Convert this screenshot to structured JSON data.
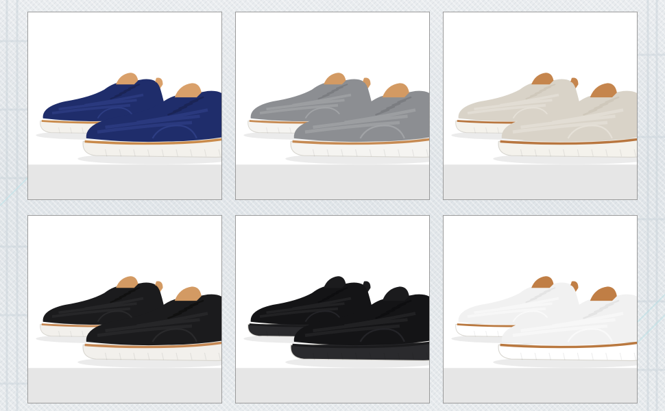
{
  "page": {
    "background_color": "#e4e8eb",
    "frame_border_color": "#9a9a9a",
    "footer_strip_color": "#e6e6e6"
  },
  "products": [
    {
      "colorway": "navy",
      "upper_color": "#1f2d6b",
      "knit_color": "#2f3f86",
      "sole_color": "#f3f1ec",
      "welt_color": "#c98a4a",
      "heel_tab_color": "#d9a06a",
      "lace_color": "#1a2456"
    },
    {
      "colorway": "gray",
      "upper_color": "#8c8e92",
      "knit_color": "#a3a5a8",
      "sole_color": "#f5f4f1",
      "welt_color": "#c68a52",
      "heel_tab_color": "#d39a63",
      "lace_color": "#7b7d81"
    },
    {
      "colorway": "beige",
      "upper_color": "#d9d3c8",
      "knit_color": "#e6e1d8",
      "sole_color": "#f4f2ec",
      "welt_color": "#b8763f",
      "heel_tab_color": "#c5854d",
      "lace_color": "#cfc8bb"
    },
    {
      "colorway": "black",
      "upper_color": "#1b1b1d",
      "knit_color": "#2b2b2e",
      "sole_color": "#f2f0ec",
      "welt_color": "#c58752",
      "heel_tab_color": "#d39a63",
      "lace_color": "#111111"
    },
    {
      "colorway": "all-black",
      "upper_color": "#141416",
      "knit_color": "#26262a",
      "sole_color": "#2a2a2d",
      "welt_color": "#1b1b1d",
      "heel_tab_color": "#1b1b1d",
      "lace_color": "#0e0e10"
    },
    {
      "colorway": "white",
      "upper_color": "#f1f1f1",
      "knit_color": "#fafafa",
      "sole_color": "#ffffff",
      "welt_color": "#b9783f",
      "heel_tab_color": "#c07e45",
      "lace_color": "#e4e4e4"
    }
  ]
}
